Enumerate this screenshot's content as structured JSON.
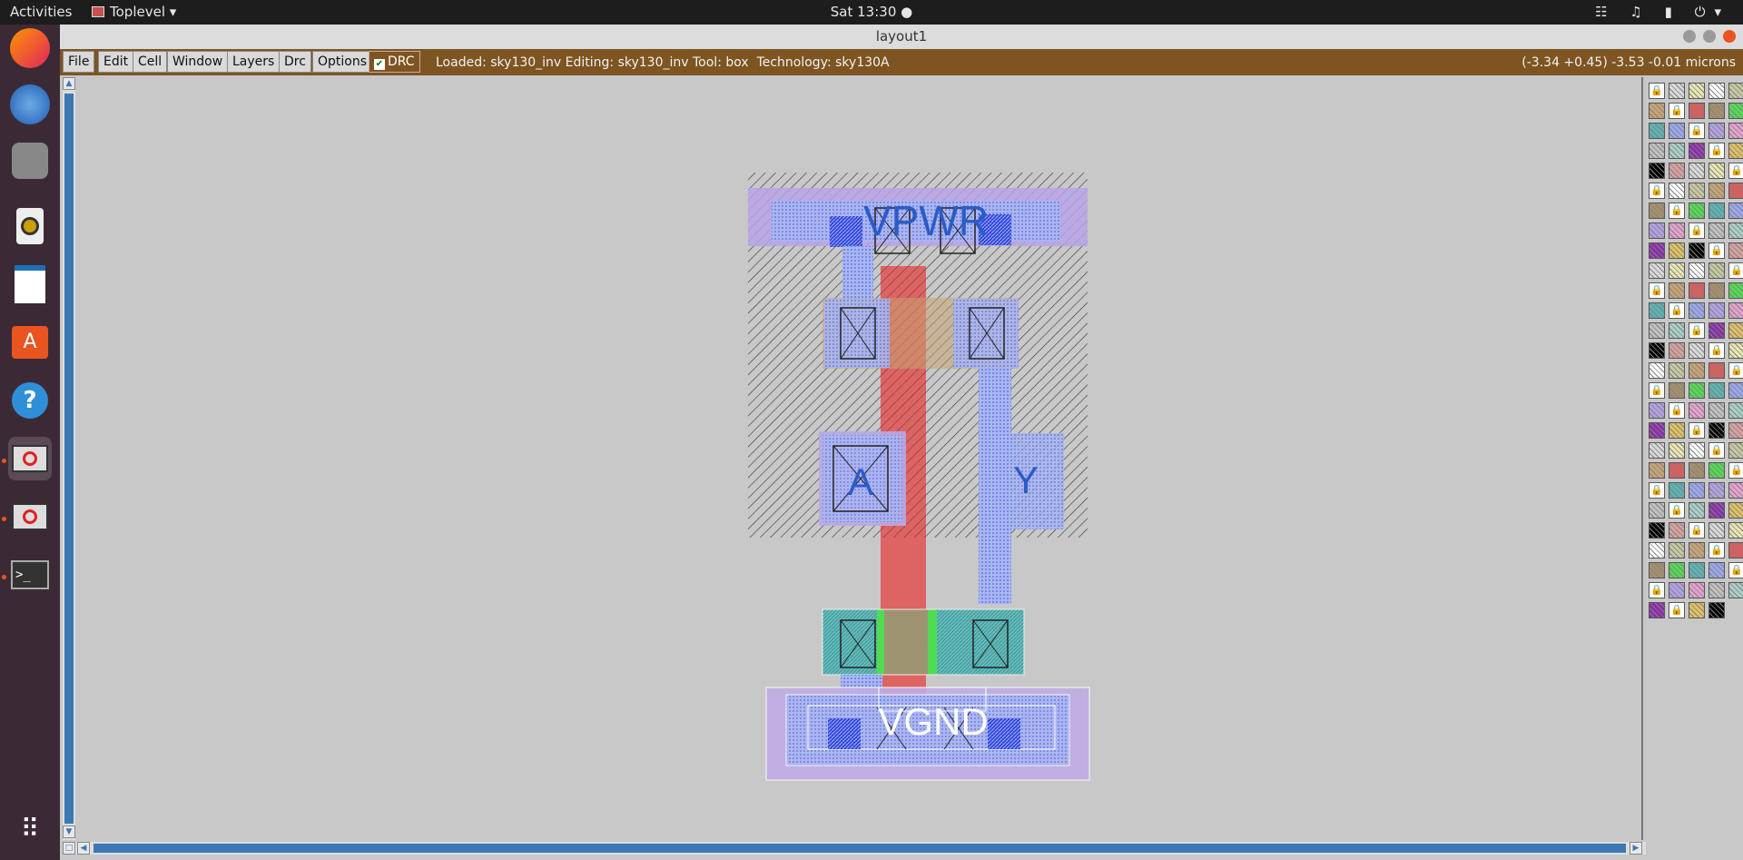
{
  "topbar": {
    "activities": "Activities",
    "app_menu": "Toplevel",
    "clock": "Sat 13:30 ●",
    "tray_icons": [
      "network-icon",
      "volume-icon",
      "battery-icon",
      "power-menu-icon"
    ],
    "tray_glyphs": "☷ ♫ ▮ ⏻▾"
  },
  "dock": {
    "items": [
      "firefox-icon",
      "thunderbird-icon",
      "files-icon",
      "rhythmbox-icon",
      "writer-icon",
      "software-center-icon",
      "help-icon",
      "magic-window-icon",
      "magic-window-icon",
      "terminal-icon",
      "app-grid-icon"
    ]
  },
  "window": {
    "title": "layout1"
  },
  "menubar": {
    "items": [
      "File",
      "Edit",
      "Cell",
      "Window",
      "Layers",
      "Drc",
      "Options"
    ],
    "drc_toggle": "DRC",
    "status": "Loaded: sky130_inv Editing: sky130_inv Tool: box  Technology: sky130A",
    "coords": "(-3.34 +0.45) -3.53 -0.01 microns"
  },
  "layout": {
    "labels": {
      "vpwr": "VPWR",
      "a": "A",
      "y": "Y",
      "vgnd": "VGND"
    }
  },
  "colors": {
    "menubar": "#7e5421",
    "poly": "#e05a5a",
    "metal1": "#9aa8f0",
    "li": "#b4a0e6",
    "ndiff": "#5ab4b4",
    "ntap": "#50dc50"
  }
}
